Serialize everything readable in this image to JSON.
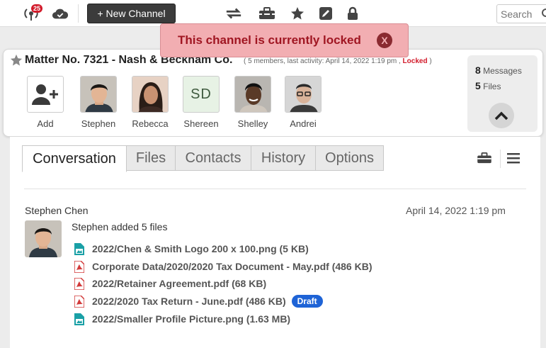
{
  "toolbar": {
    "notification_count": "25",
    "new_channel_label": "+ New Channel",
    "search_placeholder": "Search"
  },
  "alert": {
    "message": "This channel is currently locked",
    "close_label": "X"
  },
  "channel": {
    "title": "Matter No. 7321 - Nash & Beckham Co.",
    "meta_prefix": "( 5 members, last activity: April 14, 2022 1:19 pm ,",
    "meta_locked": "Locked",
    "meta_suffix": ")",
    "members": [
      {
        "name": "Add"
      },
      {
        "name": "Stephen"
      },
      {
        "name": "Rebecca"
      },
      {
        "name": "Shereen",
        "initials": "SD"
      },
      {
        "name": "Shelley"
      },
      {
        "name": "Andrei"
      }
    ],
    "stats": {
      "messages_count": "8",
      "messages_label": "Messages",
      "files_count": "5",
      "files_label": "Files"
    }
  },
  "tabs": [
    {
      "label": "Conversation",
      "active": true
    },
    {
      "label": "Files"
    },
    {
      "label": "Contacts"
    },
    {
      "label": "History"
    },
    {
      "label": "Options"
    }
  ],
  "message": {
    "author": "Stephen Chen",
    "timestamp": "April 14, 2022 1:19 pm",
    "text": "Stephen added 5 files",
    "files": [
      {
        "name": "2022/Chen & Smith Logo 200 x 100.png (5 KB)",
        "type": "image"
      },
      {
        "name": "Corporate Data/2020/2020 Tax Document - May.pdf (486 KB)",
        "type": "pdf"
      },
      {
        "name": "2022/Retainer Agreement.pdf (68 KB)",
        "type": "pdf"
      },
      {
        "name": "2022/2020 Tax Return - June.pdf (486 KB)",
        "type": "pdf",
        "badge": "Draft"
      },
      {
        "name": "2022/Smaller Profile Picture.png (1.63 MB)",
        "type": "image"
      }
    ]
  },
  "colors": {
    "alert_bg": "#f2aeb2",
    "alert_text": "#a01622",
    "draft_badge": "#1e63d6",
    "locked_text": "#d21a2a"
  }
}
